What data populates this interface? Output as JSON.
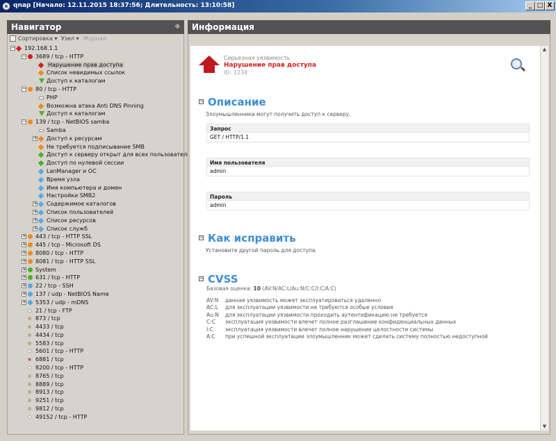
{
  "window": {
    "title": "qnap [Начало: 12.11.2015 18:37:56; Длительность: 13:10:58]",
    "btn_min": "_",
    "btn_max": "□",
    "btn_close": "X"
  },
  "navigator": {
    "title": "Навигатор",
    "pin": "✥",
    "toolbar": {
      "sort": "Сортировка ▾",
      "node": "Узел ▾",
      "journal": "Журнал"
    },
    "tree": [
      {
        "label": "192.168.1.1",
        "depth": 0,
        "expand": "-",
        "icon": "host-red",
        "color": "#d02020"
      },
      {
        "label": "3689 / tcp - HTTP",
        "depth": 1,
        "expand": "-",
        "icon": "port-red",
        "color": "#d02020"
      },
      {
        "label": "Нарушение прав доступа",
        "depth": 2,
        "expand": "",
        "icon": "diamond",
        "color": "#d02020",
        "selected": true
      },
      {
        "label": "Список невидимых ссылок",
        "depth": 2,
        "expand": "",
        "icon": "diamond",
        "color": "#f08a20"
      },
      {
        "label": "Доступ к каталогам",
        "depth": 2,
        "expand": "",
        "icon": "down",
        "color": "#4caf2a"
      },
      {
        "label": "80 / tcp - HTTP",
        "depth": 1,
        "expand": "-",
        "icon": "port",
        "color": "#f08a20"
      },
      {
        "label": "PHP",
        "depth": 2,
        "expand": "",
        "icon": "flat",
        "color": "#ffffff"
      },
      {
        "label": "Возможна атака Anti DNS Pinning",
        "depth": 2,
        "expand": "",
        "icon": "diamond",
        "color": "#f08a20"
      },
      {
        "label": "Доступ к каталогам",
        "depth": 2,
        "expand": "",
        "icon": "down",
        "color": "#4caf2a"
      },
      {
        "label": "139 / tcp - NetBIOS samba",
        "depth": 1,
        "expand": "-",
        "icon": "port",
        "color": "#f08a20"
      },
      {
        "label": "Samba",
        "depth": 2,
        "expand": "",
        "icon": "flat",
        "color": "#ffffff"
      },
      {
        "label": "Доступ к ресурсам",
        "depth": 2,
        "expand": "+",
        "icon": "diamond",
        "color": "#f08a20"
      },
      {
        "label": "Не требуется подписывание SMB",
        "depth": 2,
        "expand": "",
        "icon": "diamond",
        "color": "#f08a20"
      },
      {
        "label": "Доступ к серверу открыт для всех пользователей",
        "depth": 2,
        "expand": "",
        "icon": "diamond",
        "color": "#4caf2a"
      },
      {
        "label": "Доступ по нулевой сессии",
        "depth": 2,
        "expand": "",
        "icon": "diamond",
        "color": "#4caf2a"
      },
      {
        "label": "LanManager и ОС",
        "depth": 2,
        "expand": "",
        "icon": "diamond",
        "color": "#5aa8e0"
      },
      {
        "label": "Время узла",
        "depth": 2,
        "expand": "",
        "icon": "diamond",
        "color": "#5aa8e0"
      },
      {
        "label": "Имя компьютера и домен",
        "depth": 2,
        "expand": "",
        "icon": "diamond",
        "color": "#5aa8e0"
      },
      {
        "label": "Настройки SMB2",
        "depth": 2,
        "expand": "",
        "icon": "diamond",
        "color": "#5aa8e0"
      },
      {
        "label": "Содержимое каталогов",
        "depth": 2,
        "expand": "+",
        "icon": "diamond",
        "color": "#5aa8e0"
      },
      {
        "label": "Список пользователей",
        "depth": 2,
        "expand": "+",
        "icon": "diamond",
        "color": "#5aa8e0"
      },
      {
        "label": "Список ресурсов",
        "depth": 2,
        "expand": "+",
        "icon": "diamond",
        "color": "#5aa8e0"
      },
      {
        "label": "Список служб",
        "depth": 2,
        "expand": "+",
        "icon": "diamond",
        "color": "#5aa8e0"
      },
      {
        "label": "443 / tcp - HTTP SSL",
        "depth": 1,
        "expand": "+",
        "icon": "port",
        "color": "#f08a20"
      },
      {
        "label": "445 / tcp - Microsoft DS",
        "depth": 1,
        "expand": "+",
        "icon": "port",
        "color": "#f08a20"
      },
      {
        "label": "8080 / tcp - HTTP",
        "depth": 1,
        "expand": "+",
        "icon": "port",
        "color": "#f08a20"
      },
      {
        "label": "8081 / tcp - HTTP SSL",
        "depth": 1,
        "expand": "+",
        "icon": "port",
        "color": "#f08a20"
      },
      {
        "label": "System",
        "depth": 1,
        "expand": "+",
        "icon": "port",
        "color": "#4caf2a"
      },
      {
        "label": "631 / tcp - HTTP",
        "depth": 1,
        "expand": "+",
        "icon": "port",
        "color": "#4caf2a"
      },
      {
        "label": "22 / tcp - SSH",
        "depth": 1,
        "expand": "+",
        "icon": "port",
        "color": "#5aa8e0"
      },
      {
        "label": "137 / udp - NetBIOS Name",
        "depth": 1,
        "expand": "+",
        "icon": "port",
        "color": "#5aa8e0"
      },
      {
        "label": "5353 / udp - mDNS",
        "depth": 1,
        "expand": "+",
        "icon": "port",
        "color": "#5aa8e0"
      },
      {
        "label": "21 / tcp - FTP",
        "depth": 1,
        "expand": "",
        "icon": "dot",
        "color": "#ffffff"
      },
      {
        "label": "873 / tcp",
        "depth": 1,
        "expand": "",
        "icon": "dot",
        "color": "#c8b060"
      },
      {
        "label": "4433 / tcp",
        "depth": 1,
        "expand": "",
        "icon": "dot",
        "color": "#c8b060"
      },
      {
        "label": "4434 / tcp",
        "depth": 1,
        "expand": "",
        "icon": "dot",
        "color": "#c8b060"
      },
      {
        "label": "5583 / tcp",
        "depth": 1,
        "expand": "",
        "icon": "dot",
        "color": "#c8b060"
      },
      {
        "label": "5601 / tcp - HTTP",
        "depth": 1,
        "expand": "",
        "icon": "dot",
        "color": "#ffffff"
      },
      {
        "label": "6881 / tcp",
        "depth": 1,
        "expand": "",
        "icon": "dot",
        "color": "#e04040"
      },
      {
        "label": "8200 / tcp - HTTP",
        "depth": 1,
        "expand": "",
        "icon": "dot",
        "color": "#ffffff"
      },
      {
        "label": "8765 / tcp",
        "depth": 1,
        "expand": "",
        "icon": "dot",
        "color": "#c8b060"
      },
      {
        "label": "8889 / tcp",
        "depth": 1,
        "expand": "",
        "icon": "dot",
        "color": "#c8b060"
      },
      {
        "label": "8913 / tcp",
        "depth": 1,
        "expand": "",
        "icon": "dot",
        "color": "#c8b060"
      },
      {
        "label": "9251 / tcp",
        "depth": 1,
        "expand": "",
        "icon": "dot",
        "color": "#c8b060"
      },
      {
        "label": "9812 / tcp",
        "depth": 1,
        "expand": "",
        "icon": "dot",
        "color": "#c8b060"
      },
      {
        "label": "49152 / tcp - HTTP",
        "depth": 1,
        "expand": "",
        "icon": "dot",
        "color": "#ffffff"
      }
    ]
  },
  "info": {
    "title": "Информация",
    "severity_label": "Серьезная уязвимость",
    "vuln_title": "Нарушение прав доступа",
    "vuln_id": "ID: 1234",
    "description": {
      "heading": "Описание",
      "text": "Злоумышленники могут получить доступ к серверу.",
      "fields": [
        {
          "label": "Запрос",
          "value": "GET / HTTP/1.1"
        },
        {
          "label": "Имя пользователя",
          "value": "admin"
        },
        {
          "label": "Пароль",
          "value": "admin"
        }
      ]
    },
    "fix": {
      "heading": "Как исправить",
      "text": "Установите другой пароль для доступа."
    },
    "cvss": {
      "heading": "CVSS",
      "base_label": "Базовая оценка:",
      "base_score": "10",
      "base_vector": "(AV:N/AC:L/Au:N/C:C/I:C/A:C)",
      "rows": [
        {
          "k": "AV:N",
          "v": "данная уязвимость может эксплуатироваться удаленно"
        },
        {
          "k": "AC:L",
          "v": "для эксплуатации уязвимости не требуются особые условия"
        },
        {
          "k": "Au:N",
          "v": "для эксплуатации уязвимости проходить аутентификацию не требуется"
        },
        {
          "k": "C:C",
          "v": "эксплуатация уязвимости влечет полное разглашение конфиденциальных данных"
        },
        {
          "k": "I:C",
          "v": "эксплуатация уязвимости влечет полное нарушение целостности системы"
        },
        {
          "k": "A:C",
          "v": "при успешной эксплуатации злоумышленник может сделать систему полностью недоступной"
        }
      ]
    }
  }
}
